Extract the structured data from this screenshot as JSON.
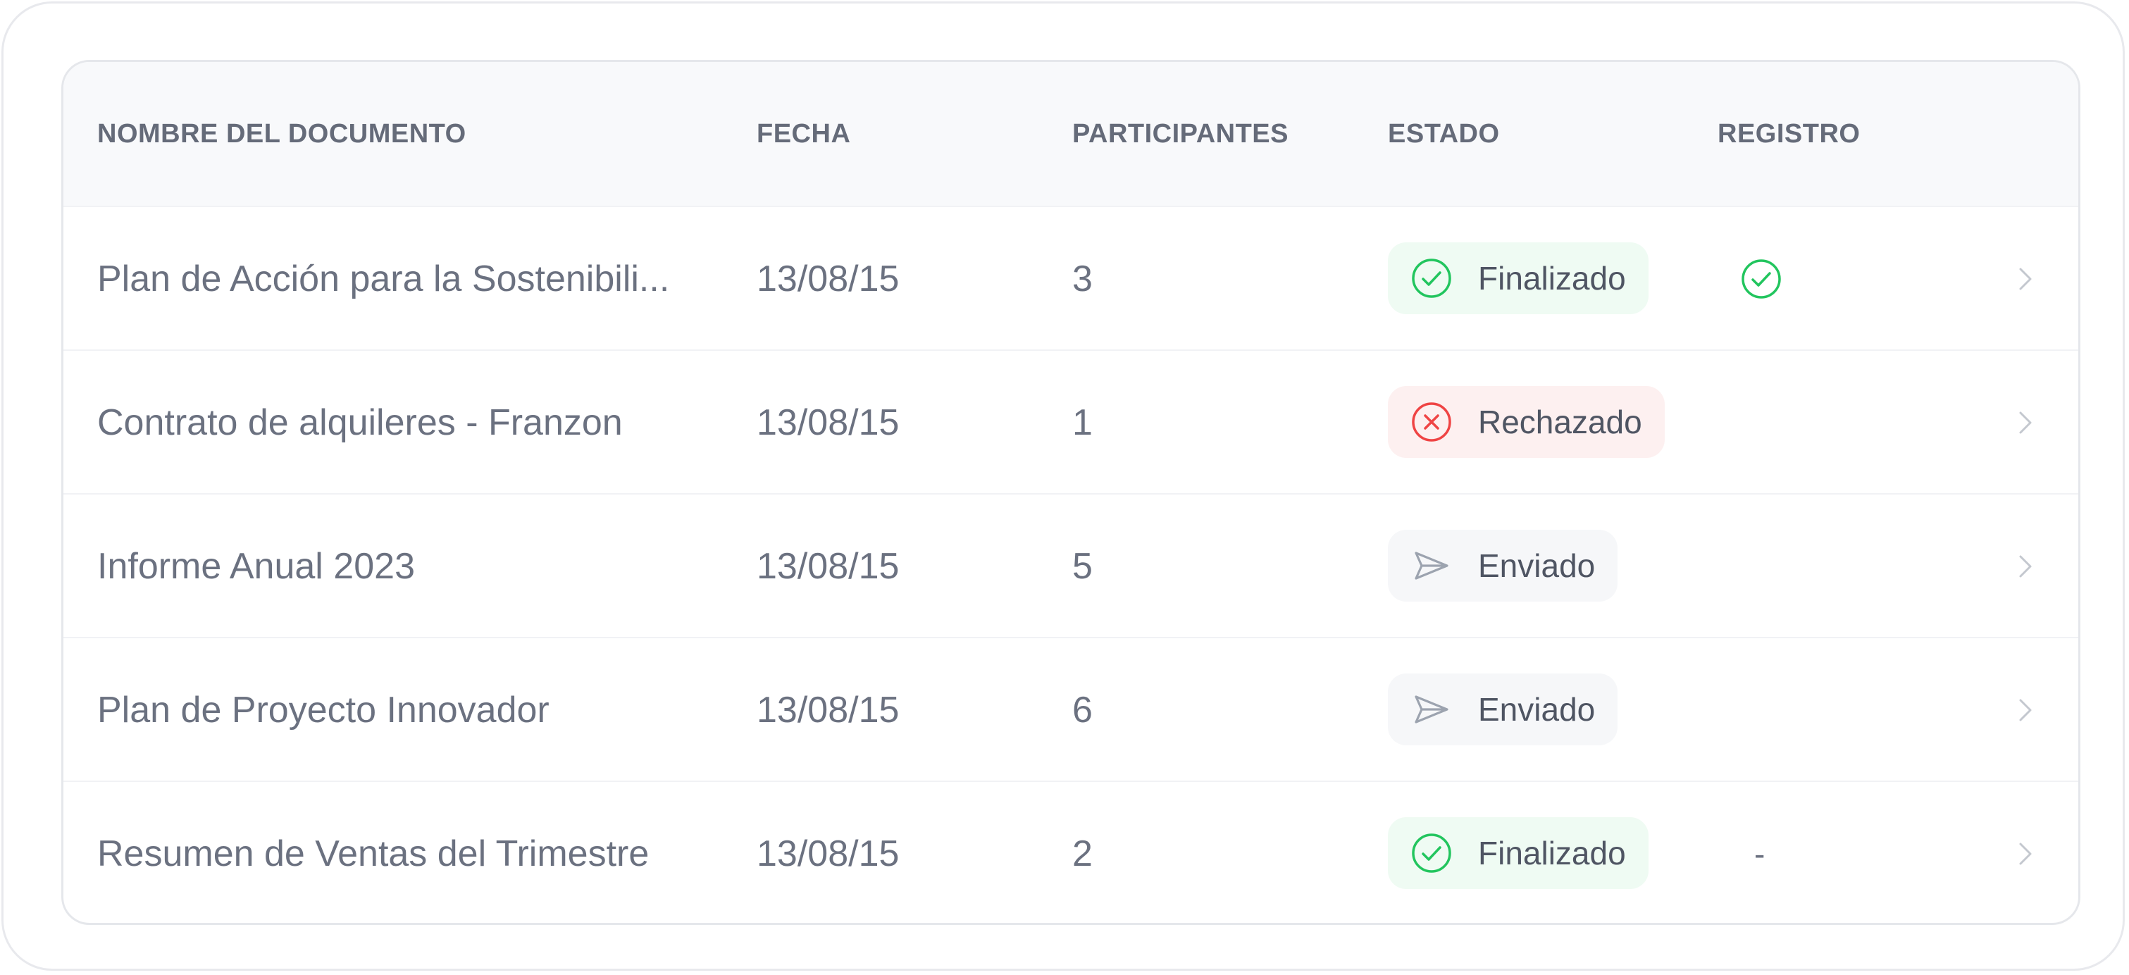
{
  "table": {
    "headers": {
      "name": "NOMBRE DEL DOCUMENTO",
      "date": "FECHA",
      "participants": "PARTICIPANTES",
      "status": "ESTADO",
      "registry": "REGISTRO"
    },
    "rows": [
      {
        "name": "Plan de Acción para la Sostenibili...",
        "date": "13/08/15",
        "participants": "3",
        "status": "Finalizado",
        "status_icon": "check-circle-icon",
        "registry": "check-circle-icon",
        "registry_text": ""
      },
      {
        "name": "Contrato de alquileres - Franzon",
        "date": "13/08/15",
        "participants": "1",
        "status": "Rechazado",
        "status_icon": "x-circle-icon",
        "registry": "",
        "registry_text": ""
      },
      {
        "name": "Informe Anual 2023",
        "date": "13/08/15",
        "participants": "5",
        "status": "Enviado",
        "status_icon": "send-icon",
        "registry": "",
        "registry_text": ""
      },
      {
        "name": "Plan de Proyecto Innovador",
        "date": "13/08/15",
        "participants": "6",
        "status": "Enviado",
        "status_icon": "send-icon",
        "registry": "",
        "registry_text": ""
      },
      {
        "name": "Resumen de Ventas del Trimestre",
        "date": "13/08/15",
        "participants": "2",
        "status": "Finalizado",
        "status_icon": "check-circle-icon",
        "registry": "",
        "registry_text": "-"
      }
    ]
  },
  "colors": {
    "success": "#22c55e",
    "error": "#ef4444",
    "neutral_icon": "#9ca3af",
    "text": "#6b7180",
    "header_bg": "#f8f9fb"
  }
}
